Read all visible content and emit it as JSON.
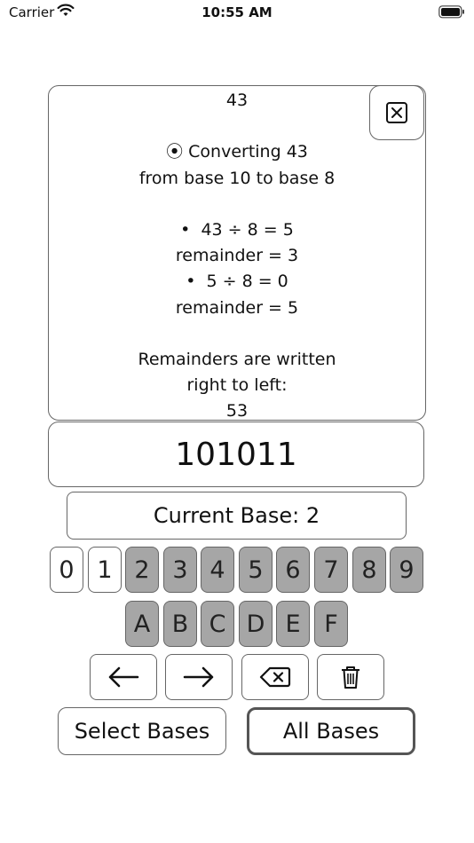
{
  "status_bar": {
    "carrier": "Carrier",
    "time": "10:55 AM"
  },
  "explanation": {
    "lines": [
      "43",
      "",
      "⦿ Converting 43",
      "from base 10 to base 8",
      "",
      "•  43 ÷ 8 = 5",
      "remainder = 3",
      "•  5 ÷ 8 = 0",
      "remainder = 5",
      "",
      "Remainders are written",
      "right to left:",
      "53"
    ]
  },
  "result": {
    "value": "101011"
  },
  "current_base": {
    "label": "Current Base: 2"
  },
  "keypad": {
    "digits": [
      "0",
      "1",
      "2",
      "3",
      "4",
      "5",
      "6",
      "7",
      "8",
      "9"
    ],
    "letters": [
      "A",
      "B",
      "C",
      "D",
      "E",
      "F"
    ]
  },
  "actions": {
    "left_icon": "arrow-left-icon",
    "right_icon": "arrow-right-icon",
    "backspace_icon": "backspace-icon",
    "clear_icon": "trash-icon"
  },
  "bottom": {
    "select_bases": "Select Bases",
    "all_bases": "All Bases"
  },
  "colors": {
    "disabled_key": "#a6a6a6",
    "border": "#666666"
  }
}
